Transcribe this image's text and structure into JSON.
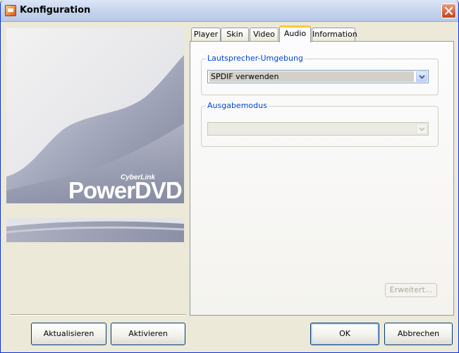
{
  "window": {
    "title": "Konfiguration"
  },
  "logo": {
    "brand_small": "CyberLink",
    "brand": "PowerDVD",
    "trademark": "™"
  },
  "tabs": [
    {
      "label": "Player"
    },
    {
      "label": "Skin"
    },
    {
      "label": "Video"
    },
    {
      "label": "Audio",
      "active": true
    },
    {
      "label": "Information"
    }
  ],
  "audio": {
    "speaker_group_label": "Lautsprecher-Umgebung",
    "speaker_value": "SPDIF verwenden",
    "output_group_label": "Ausgabemodus",
    "output_value": "",
    "advanced_label": "Erweitert..."
  },
  "buttons": {
    "update": "Aktualisieren",
    "activate": "Aktivieren",
    "ok": "OK",
    "cancel": "Abbrechen"
  },
  "colors": {
    "group_label": "#0046d5",
    "active_tab_accent": "#ffc83c",
    "title_close": "#c4421a"
  }
}
